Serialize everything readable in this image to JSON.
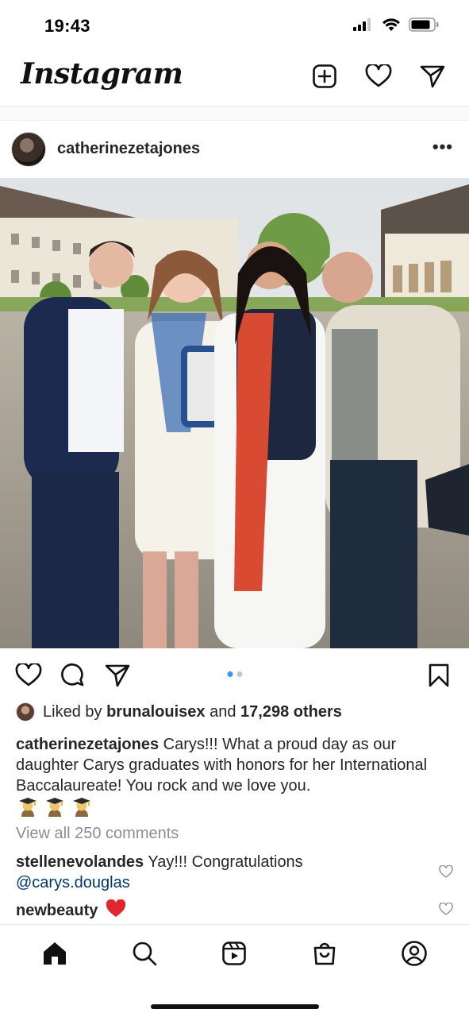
{
  "status_bar": {
    "time": "19:43",
    "icons": [
      "signal-icon",
      "wifi-icon",
      "battery-icon"
    ]
  },
  "header": {
    "logo": "Instagram",
    "actions": [
      "new-post-icon",
      "activity-heart-icon",
      "direct-message-icon"
    ]
  },
  "post": {
    "username": "catherinezetajones",
    "more_label": "•••",
    "carousel": {
      "total": 2,
      "active": 1
    },
    "likes": {
      "prefix": "Liked by",
      "liker": "brunalouisex",
      "and": "and",
      "count": "17,298 others"
    },
    "caption": {
      "username": "catherinezetajones",
      "text": "Carys!!! What a proud day as our daughter Carys graduates with honors for her International  Baccalaureate! You rock and we love you.",
      "emojis": [
        "student-emoji",
        "student-emoji",
        "student-emoji"
      ]
    },
    "view_comments": "View all 250 comments",
    "comments": [
      {
        "username": "stellenevolandes",
        "text": "Yay!!! Congratulations",
        "mention": "@carys.douglas"
      },
      {
        "username": "newbeauty",
        "text": "",
        "emoji": "red-heart-emoji"
      }
    ]
  },
  "bottom_nav": {
    "items": [
      "home-icon",
      "search-icon",
      "reels-icon",
      "shop-icon",
      "profile-icon"
    ],
    "active": "home-icon"
  },
  "colors": {
    "link": "#00376b",
    "muted": "#8e8e8e",
    "text": "#262626",
    "carousel_active": "#3897f0"
  }
}
